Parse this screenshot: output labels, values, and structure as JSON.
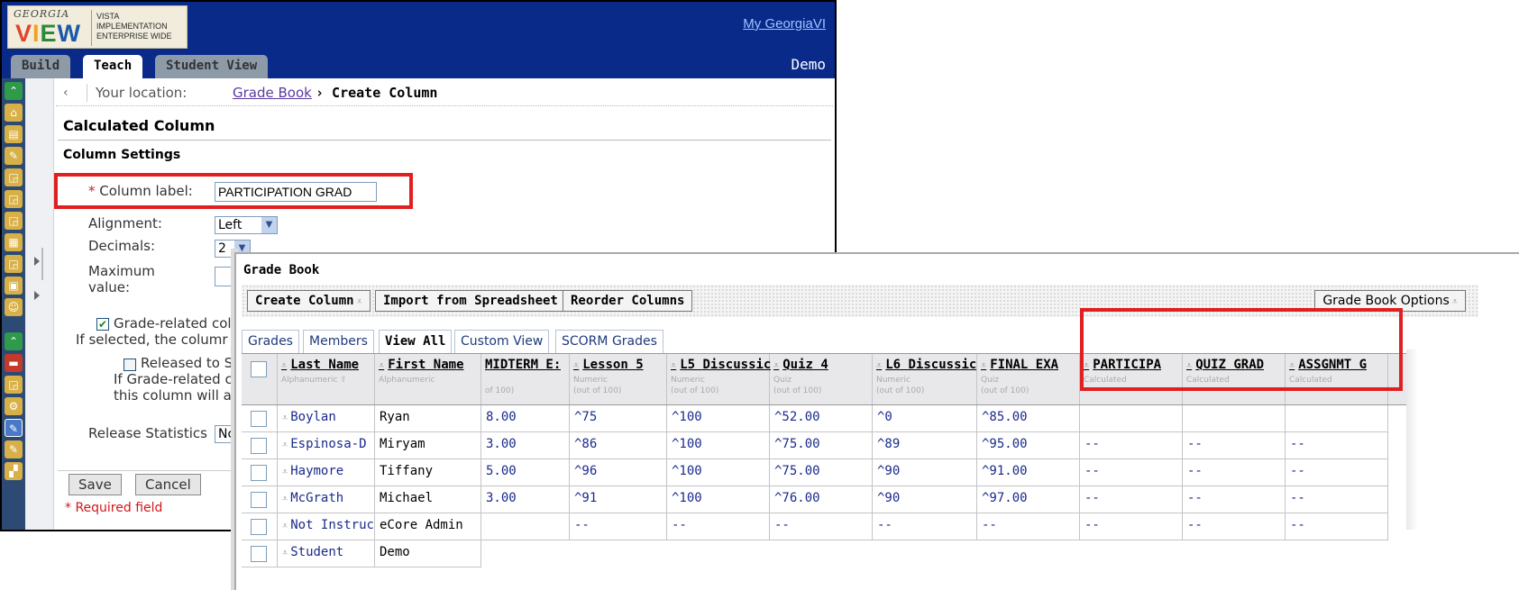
{
  "header": {
    "logo_top": "GEORGIA",
    "logo_main": [
      "V",
      "I",
      "E",
      "W"
    ],
    "logo_sub": [
      "VISTA",
      "IMPLEMENTATION",
      "ENTERPRISE WIDE"
    ],
    "my_link": "My GeorgiaVI",
    "user": "Demo"
  },
  "tabs": {
    "build": "Build",
    "teach": "Teach",
    "student": "Student View"
  },
  "breadcrumb": {
    "prefix": "Your location:",
    "link": "Grade Book",
    "current": "› Create Column"
  },
  "form": {
    "title": "Calculated Column",
    "settings_title": "Column Settings",
    "column_label_label": "Column label:",
    "column_label_value": "PARTICIPATION GRAD",
    "alignment_label": "Alignment:",
    "alignment_value": "Left",
    "decimals_label": "Decimals:",
    "decimals_value": "2",
    "maximum_label_1": "Maximum",
    "maximum_label_2": "value:",
    "grade_related_text": "Grade-related colu",
    "grade_related_desc": "If selected, the columr",
    "released_text": "Released to St",
    "released_desc_1": "If Grade-related co",
    "released_desc_2": "this column will ap",
    "release_stats_label": "Release Statistics",
    "release_stats_value": "Nc",
    "save": "Save",
    "cancel": "Cancel",
    "required_note": "* Required field"
  },
  "gradebook": {
    "title": "Grade Book",
    "toolbar": {
      "create": "Create Column",
      "import": "Import from Spreadsheet",
      "reorder": "Reorder Columns",
      "options": "Grade Book Options"
    },
    "tabs": [
      "Grades",
      "Members",
      "View All",
      "Custom View",
      "SCORM Grades"
    ],
    "columns": [
      {
        "title": "Last Name",
        "sub": "Alphanumeric ⇧",
        "sub2": ""
      },
      {
        "title": "First Name",
        "sub": "Alphanumeric",
        "sub2": ""
      },
      {
        "title": "MIDTERM E:",
        "sub": "",
        "sub2": "of 100)"
      },
      {
        "title": "Lesson 5",
        "sub": "Numeric",
        "sub2": "(out of 100)"
      },
      {
        "title": "L5 Discussic",
        "sub": "Numeric",
        "sub2": "(out of 100)"
      },
      {
        "title": "Quiz 4",
        "sub": "Quiz",
        "sub2": "(out of 100)"
      },
      {
        "title": "L6 Discussic",
        "sub": "Numeric",
        "sub2": "(out of 100)"
      },
      {
        "title": "FINAL EXA",
        "sub": "Quiz",
        "sub2": "(out of 100)"
      },
      {
        "title": "PARTICIPA",
        "sub": "Calculated",
        "sub2": ""
      },
      {
        "title": "QUIZ GRAD",
        "sub": "Calculated",
        "sub2": ""
      },
      {
        "title": "ASSGNMT G",
        "sub": "Calculated",
        "sub2": ""
      }
    ],
    "rows": [
      {
        "last": "Boylan",
        "first": "Ryan",
        "cells": [
          "8.00",
          "^75",
          "^100",
          "^52.00",
          "^0",
          "^85.00",
          "",
          "",
          ""
        ]
      },
      {
        "last": "Espinosa-D",
        "first": "Miryam",
        "cells": [
          "3.00",
          "^86",
          "^100",
          "^75.00",
          "^89",
          "^95.00",
          "--",
          "--",
          "--"
        ]
      },
      {
        "last": "Haymore",
        "first": "Tiffany",
        "cells": [
          "5.00",
          "^96",
          "^100",
          "^75.00",
          "^90",
          "^91.00",
          "--",
          "--",
          "--"
        ]
      },
      {
        "last": "McGrath",
        "first": "Michael",
        "cells": [
          "3.00",
          "^91",
          "^100",
          "^76.00",
          "^90",
          "^97.00",
          "--",
          "--",
          "--"
        ]
      },
      {
        "last": "Not Instruct",
        "first": "eCore Admin",
        "cells": [
          "",
          "",
          "",
          "",
          "",
          "",
          "",
          "",
          ""
        ]
      },
      {
        "last": "Not Instruct",
        "first": "eCore Admin",
        "cells": [
          "",
          "--",
          "--",
          "--",
          "--",
          "--",
          "--",
          "--",
          "--"
        ]
      },
      {
        "last": "Student",
        "first": "Demo",
        "cells": [
          "",
          "",
          "",
          "",
          "",
          "",
          "",
          "",
          ""
        ]
      }
    ]
  },
  "colors": {
    "brand_blue": "#0a2a8a",
    "highlight_red": "#e02020",
    "link_blue": "#1a2a8a",
    "required_red": "#d21818"
  }
}
